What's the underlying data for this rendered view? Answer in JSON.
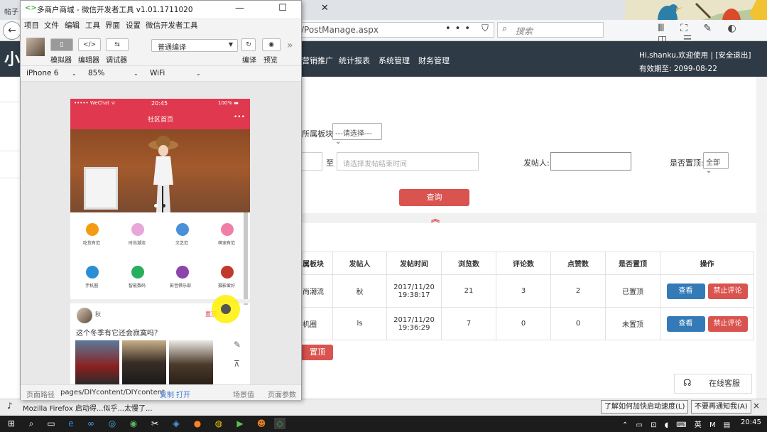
{
  "browser": {
    "tab_text": "帖子",
    "url_fragment": "/PostManage.aspx",
    "search_placeholder": "搜索",
    "url_icons": "••• ⛉ ☆",
    "toolbar_icons": "Ⅲ ⛶ ✎ ◐ ◫ ☰"
  },
  "app": {
    "logo_text": "小",
    "nav_items": [
      "营销推广",
      "统计报表",
      "系统管理",
      "财务管理"
    ],
    "greeting": "Hi,shanku,欢迎使用 | [安全退出]",
    "expiry": "有效期至:   2099-08-22"
  },
  "filters": {
    "board_label": "所属板块:",
    "board_select": "---请选择---",
    "to_label": "至",
    "end_time_placeholder": "请选择发帖结束时间",
    "poster_label": "发帖人:",
    "poster_value": "",
    "pinned_label": "是否置顶:",
    "pinned_select": "全部",
    "query_button": "查询",
    "collapse_icon": "︽"
  },
  "table": {
    "headers": [
      "属板块",
      "发帖人",
      "发帖时间",
      "浏览数",
      "评论数",
      "点赞数",
      "是否置顶",
      "操作"
    ],
    "rows": [
      {
        "board": "尚潮流",
        "poster": "秋",
        "date": "2017/11/20",
        "time": "19:38:17",
        "views": "21",
        "comments": "3",
        "likes": "2",
        "pinned": "已置顶",
        "view_btn": "查看",
        "ban_btn": "禁止评论"
      },
      {
        "board": "机圈",
        "poster": "ls",
        "date": "2017/11/20",
        "time": "19:36:29",
        "views": "7",
        "comments": "0",
        "likes": "0",
        "pinned": "未置顶",
        "view_btn": "查看",
        "ban_btn": "禁止评论"
      }
    ],
    "bottom_button": "置顶"
  },
  "online_service": "在线客服",
  "notification": {
    "text": "Mozilla Firefox 启动得...似乎...太慢了...",
    "btn_speed": "了解如何加快启动速度(L)",
    "btn_dismiss": "不要再通知我(A)",
    "close": "×"
  },
  "taskbar": {
    "time": "20:45",
    "tray": "⌃ ▭ ⊡ ◖ ⌨ 英 M ▤"
  },
  "devtools": {
    "title": "多商户商城 - 微信开发者工具 v1.01.1711020",
    "logo": "<>",
    "window_controls": "— ☐ ✕",
    "menu": [
      "项目",
      "文件",
      "编辑",
      "工具",
      "界面",
      "设置",
      "微信开发者工具"
    ],
    "tools": [
      {
        "icon": "▯",
        "label": "模拟器"
      },
      {
        "icon": "</>",
        "label": "编辑器"
      },
      {
        "icon": "⇆",
        "label": "调试器"
      }
    ],
    "compile_mode": "普通编译",
    "compile_label": "编译",
    "preview_label": "预览",
    "more": "»",
    "device": "iPhone 6",
    "zoom": "85%",
    "network": "WiFi",
    "status_path_label": "页面路径",
    "status_path": "pages/DIYcontent/DIYcontent",
    "status_copy": "复制",
    "status_open": "打开",
    "status_scene": "场景值",
    "status_params": "页面参数"
  },
  "phone": {
    "carrier": "••••• WeChat ᯤ",
    "time": "20:45",
    "battery": "100% ▬",
    "title": "社区首页",
    "menu_dots": "•••",
    "grid": [
      {
        "label": "吃货有范",
        "color": "#f39c12"
      },
      {
        "label": "时尚潮流",
        "color": "#e7a7d8"
      },
      {
        "label": "文艺范",
        "color": "#4a90d9"
      },
      {
        "label": "萌宠有范",
        "color": "#f07fa8"
      },
      {
        "label": "手机圈",
        "color": "#2b8fd6"
      },
      {
        "label": "智能数码",
        "color": "#27ae60"
      },
      {
        "label": "影音俱乐部",
        "color": "#8e44ad"
      },
      {
        "label": "摄影爱好",
        "color": "#c0392b"
      }
    ],
    "post_user": "秋",
    "post_tag": "置顶",
    "post_text": "这个冬季有它还会寂寞吗？",
    "side_icons": [
      "✎",
      "⊼"
    ]
  }
}
